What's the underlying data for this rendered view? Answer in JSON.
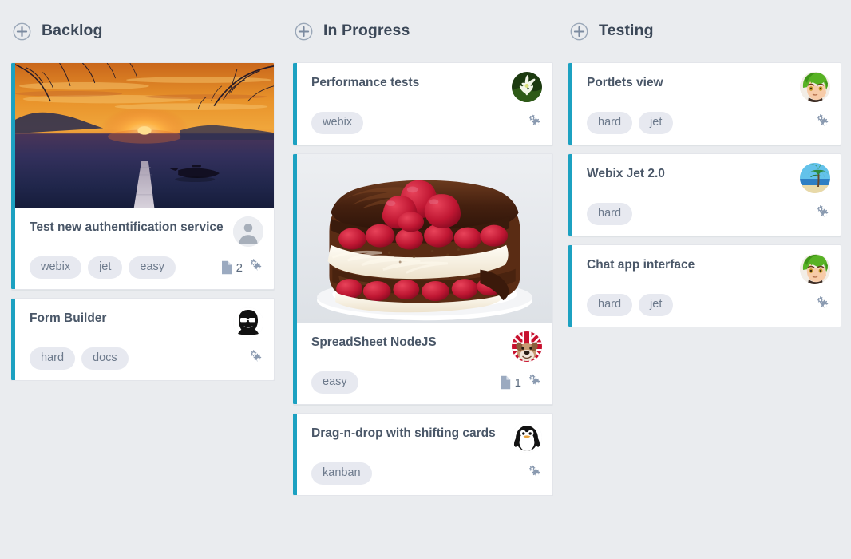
{
  "board": {
    "background_color": "#EAECEF",
    "accent_color": "#1CA1C1",
    "tag_bg_color": "#E7E9F0",
    "columns": [
      {
        "id": "backlog",
        "title": "Backlog",
        "add_icon": "plus-circle-icon",
        "cards": [
          {
            "id": "card-test-new-auth",
            "title": "Test new authentification service",
            "cover": "sunset-lake-pier-image",
            "avatar": "default-person-avatar",
            "tags": [
              "webix",
              "jet",
              "easy"
            ],
            "attachments": "2",
            "attach_icon": "document-icon",
            "gear_icon": "gears-icon"
          },
          {
            "id": "card-form-builder",
            "title": "Form Builder",
            "cover": null,
            "avatar": "cartoon-face-sunglasses-avatar",
            "tags": [
              "hard",
              "docs"
            ],
            "attachments": null,
            "attach_icon": "document-icon",
            "gear_icon": "gears-icon"
          }
        ]
      },
      {
        "id": "in-progress",
        "title": "In Progress",
        "add_icon": "plus-circle-icon",
        "cards": [
          {
            "id": "card-performance-tests",
            "title": "Performance tests",
            "cover": null,
            "avatar": "white-flower-avatar",
            "tags": [
              "webix"
            ],
            "attachments": null,
            "attach_icon": "document-icon",
            "gear_icon": "gears-icon"
          },
          {
            "id": "card-spreadsheet-nodejs",
            "title": "SpreadSheet NodeJS",
            "cover": "chocolate-strawberry-cake-image",
            "avatar": "bulldog-union-jack-avatar",
            "tags": [
              "easy"
            ],
            "attachments": "1",
            "attach_icon": "document-icon",
            "gear_icon": "gears-icon"
          },
          {
            "id": "card-drag-n-drop",
            "title": "Drag-n-drop with shifting cards",
            "cover": null,
            "avatar": "penguin-avatar",
            "tags": [
              "kanban"
            ],
            "attachments": null,
            "attach_icon": "document-icon",
            "gear_icon": "gears-icon"
          }
        ]
      },
      {
        "id": "testing",
        "title": "Testing",
        "add_icon": "plus-circle-icon",
        "cards": [
          {
            "id": "card-portlets-view",
            "title": "Portlets view",
            "cover": null,
            "avatar": "green-hair-anime-avatar",
            "tags": [
              "hard",
              "jet"
            ],
            "attachments": null,
            "attach_icon": "document-icon",
            "gear_icon": "gears-icon"
          },
          {
            "id": "card-webix-jet-2",
            "title": "Webix Jet 2.0",
            "cover": null,
            "avatar": "palm-tree-beach-avatar",
            "tags": [
              "hard"
            ],
            "attachments": null,
            "attach_icon": "document-icon",
            "gear_icon": "gears-icon"
          },
          {
            "id": "card-chat-app-interface",
            "title": "Chat app interface",
            "cover": null,
            "avatar": "green-hair-anime-avatar",
            "tags": [
              "hard",
              "jet"
            ],
            "attachments": null,
            "attach_icon": "document-icon",
            "gear_icon": "gears-icon"
          }
        ]
      }
    ]
  }
}
